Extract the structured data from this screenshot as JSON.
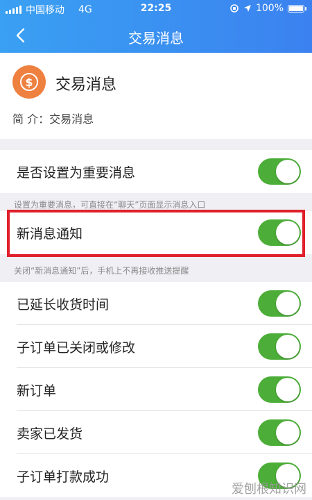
{
  "status_bar": {
    "carrier": "中国移动",
    "network": "4G",
    "time": "22:25",
    "battery": "100%"
  },
  "nav": {
    "title": "交易消息"
  },
  "header": {
    "icon": "dollar-coin-icon",
    "name": "交易消息",
    "intro": "简 介：交易消息"
  },
  "settings": [
    {
      "label": "是否设置为重要消息",
      "enabled": true
    },
    {
      "label": "新消息通知",
      "enabled": true
    },
    {
      "label": "已延长收货时间",
      "enabled": true
    },
    {
      "label": "子订单已关闭或修改",
      "enabled": true
    },
    {
      "label": "新订单",
      "enabled": true
    },
    {
      "label": "卖家已发货",
      "enabled": true
    },
    {
      "label": "子订单打款成功",
      "enabled": true
    }
  ],
  "hints": {
    "important": "设置为重要消息，可直接在“聊天”页面显示消息入口",
    "notification": "关闭“新消息通知”后，手机上不再接收推送提醒"
  },
  "colors": {
    "nav_start": "#3aa0f2",
    "nav_end": "#3b82f0",
    "toggle_on": "#4cae38",
    "highlight_border": "#e0202a",
    "avatar": "#ee8040"
  },
  "watermark": "爱刨根知识网"
}
